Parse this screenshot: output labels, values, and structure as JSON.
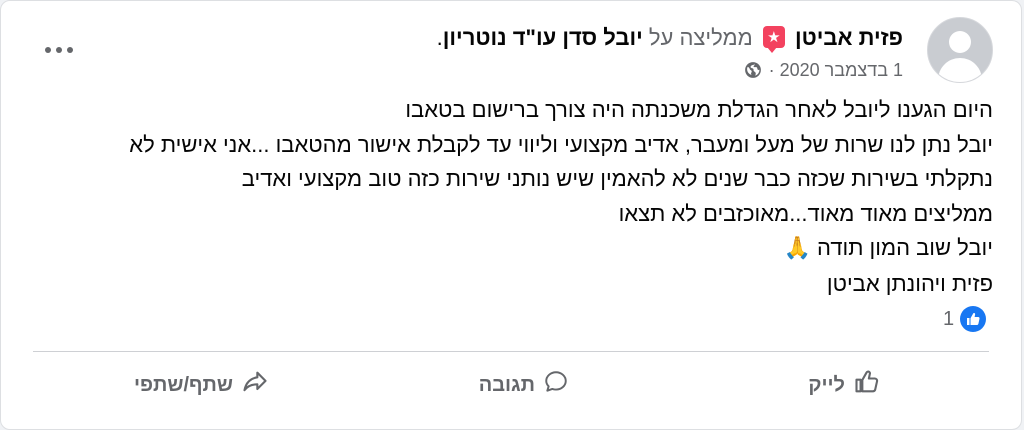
{
  "post": {
    "author": "פזית אביטן",
    "verb": "ממליצה על",
    "page_name": "יובל סדן עו\"ד נוטריון",
    "end_punct": ".",
    "date": "1 בדצמבר 2020",
    "separator": "·",
    "icons": {
      "recommend": "recommendation-star-icon",
      "privacy": "globe-icon",
      "more": "more-options-icon"
    },
    "lines": [
      "היום הגענו ליובל לאחר הגדלת משכנתה היה צורך ברישום בטאבו",
      "יובל נתן לנו שרות של מעל ומעבר, אדיב מקצועי וליווי עד לקבלת אישור מהטאבו ...אני אישית לא",
      "נתקלתי בשירות שכזה כבר שנים לא להאמין שיש נותני שירות כזה טוב מקצועי ואדיב",
      "ממליצים מאוד מאוד...מאוכזבים לא תצאו",
      "יובל שוב המון תודה",
      "פזית ויהונתן אביטן"
    ],
    "emoji": "🙏",
    "reactions": {
      "count": "1",
      "type": "like"
    }
  },
  "actions": {
    "like_label": "לייק",
    "comment_label": "תגובה",
    "share_label": "שתף/שתפי"
  },
  "colors": {
    "accent": "#1877f2",
    "badge": "#f3425f",
    "secondary_text": "#65676b",
    "primary_text": "#050505"
  }
}
